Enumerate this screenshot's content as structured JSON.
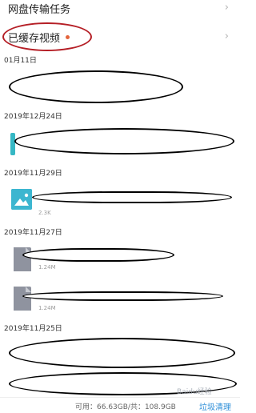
{
  "menu": {
    "transfer_label": "网盘传输任务",
    "cached_label": "已缓存视频"
  },
  "sections": [
    {
      "date": "01月11日"
    },
    {
      "date": "2019年12月24日"
    },
    {
      "date": "2019年11月29日"
    },
    {
      "date": "2019年11月27日"
    },
    {
      "date": "2019年11月25日"
    }
  ],
  "files": [
    {
      "icon": "teal-file-icon",
      "size": ""
    },
    {
      "icon": "image-icon",
      "size": "2.3K"
    },
    {
      "icon": "doc-file-icon",
      "size": "1.24M"
    },
    {
      "icon": "doc-file-icon",
      "size": "1.24M"
    }
  ],
  "footer": {
    "storage": "可用：66.63GB/共：108.9GB",
    "clean_label": "垃圾清理"
  },
  "watermark": "Baidu经验",
  "colors": {
    "annotation_ellipse": "#b51f26",
    "badge_dot": "#e4643c",
    "link_blue": "#2f8fd8"
  }
}
